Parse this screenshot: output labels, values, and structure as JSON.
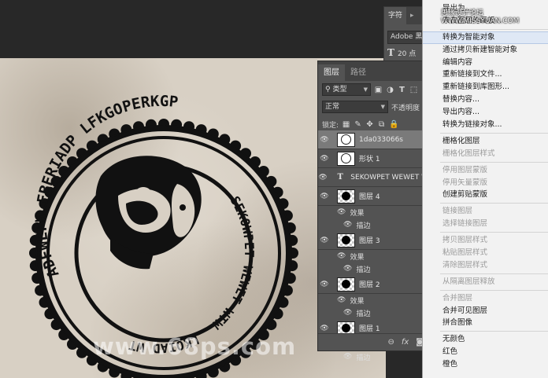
{
  "watermarks": {
    "site": "思缘设计论坛 WWW.MISSYUAN.COM",
    "canvas": "www.68ps.com"
  },
  "stamp": {
    "top_text": "ADFWEFW FBERIADP LFKGOPERKGP",
    "right_text": "SEKOWPET WEWET WTW",
    "bottom_text": "LKOIAD WT"
  },
  "char_panel": {
    "tab": "字符",
    "font_name": "Adobe 黑体",
    "size_prefix": "T",
    "size": "20 点"
  },
  "layers_panel": {
    "tabs": [
      "图层",
      "路径"
    ],
    "filter_label": "类型",
    "blend_mode": "正常",
    "opacity_label": "不透明度",
    "lock_label": "锁定:",
    "layers": [
      {
        "name": "1da033066s",
        "kind": "image",
        "selected": true
      },
      {
        "name": "形状 1",
        "kind": "shape"
      },
      {
        "name": "SEKOWPET WEWET W",
        "kind": "text"
      },
      {
        "name": "图层 4",
        "kind": "layer"
      },
      {
        "name": "图层 3",
        "kind": "layer"
      },
      {
        "name": "图层 2",
        "kind": "layer"
      },
      {
        "name": "图层 1",
        "kind": "layer"
      }
    ],
    "effects_label": "效果",
    "stroke_label": "描边",
    "footer_icons": [
      "link-icon",
      "fx-icon",
      "mask-icon"
    ]
  },
  "menu": {
    "items": [
      {
        "label": "导出为...",
        "disabled": false
      },
      {
        "label": "来自图层的画板...",
        "disabled": false
      },
      {
        "sep": true
      },
      {
        "label": "转换为智能对象",
        "disabled": false,
        "highlight": true
      },
      {
        "label": "通过拷贝新建智能对象",
        "disabled": false
      },
      {
        "label": "编辑内容",
        "disabled": false
      },
      {
        "label": "重新链接到文件...",
        "disabled": false
      },
      {
        "label": "重新链接到库图形...",
        "disabled": false
      },
      {
        "label": "替换内容...",
        "disabled": false
      },
      {
        "label": "导出内容...",
        "disabled": false
      },
      {
        "label": "转换为链接对象...",
        "disabled": false
      },
      {
        "sep": true
      },
      {
        "label": "栅格化图层",
        "disabled": false
      },
      {
        "label": "栅格化图层样式",
        "disabled": true
      },
      {
        "sep": true
      },
      {
        "label": "停用图层蒙版",
        "disabled": true
      },
      {
        "label": "停用矢量蒙版",
        "disabled": true
      },
      {
        "label": "创建剪贴蒙版",
        "disabled": false
      },
      {
        "sep": true
      },
      {
        "label": "链接图层",
        "disabled": true
      },
      {
        "label": "选择链接图层",
        "disabled": true
      },
      {
        "sep": true
      },
      {
        "label": "拷贝图层样式",
        "disabled": true
      },
      {
        "label": "粘贴图层样式",
        "disabled": true
      },
      {
        "label": "清除图层样式",
        "disabled": true
      },
      {
        "sep": true
      },
      {
        "label": "从隔离图层释放",
        "disabled": true
      },
      {
        "sep": true
      },
      {
        "label": "合并图层",
        "disabled": true
      },
      {
        "label": "合并可见图层",
        "disabled": false
      },
      {
        "label": "拼合图像",
        "disabled": false
      },
      {
        "sep": true
      },
      {
        "label": "无颜色",
        "disabled": false
      },
      {
        "label": "红色",
        "disabled": false
      },
      {
        "label": "橙色",
        "disabled": false
      }
    ]
  }
}
